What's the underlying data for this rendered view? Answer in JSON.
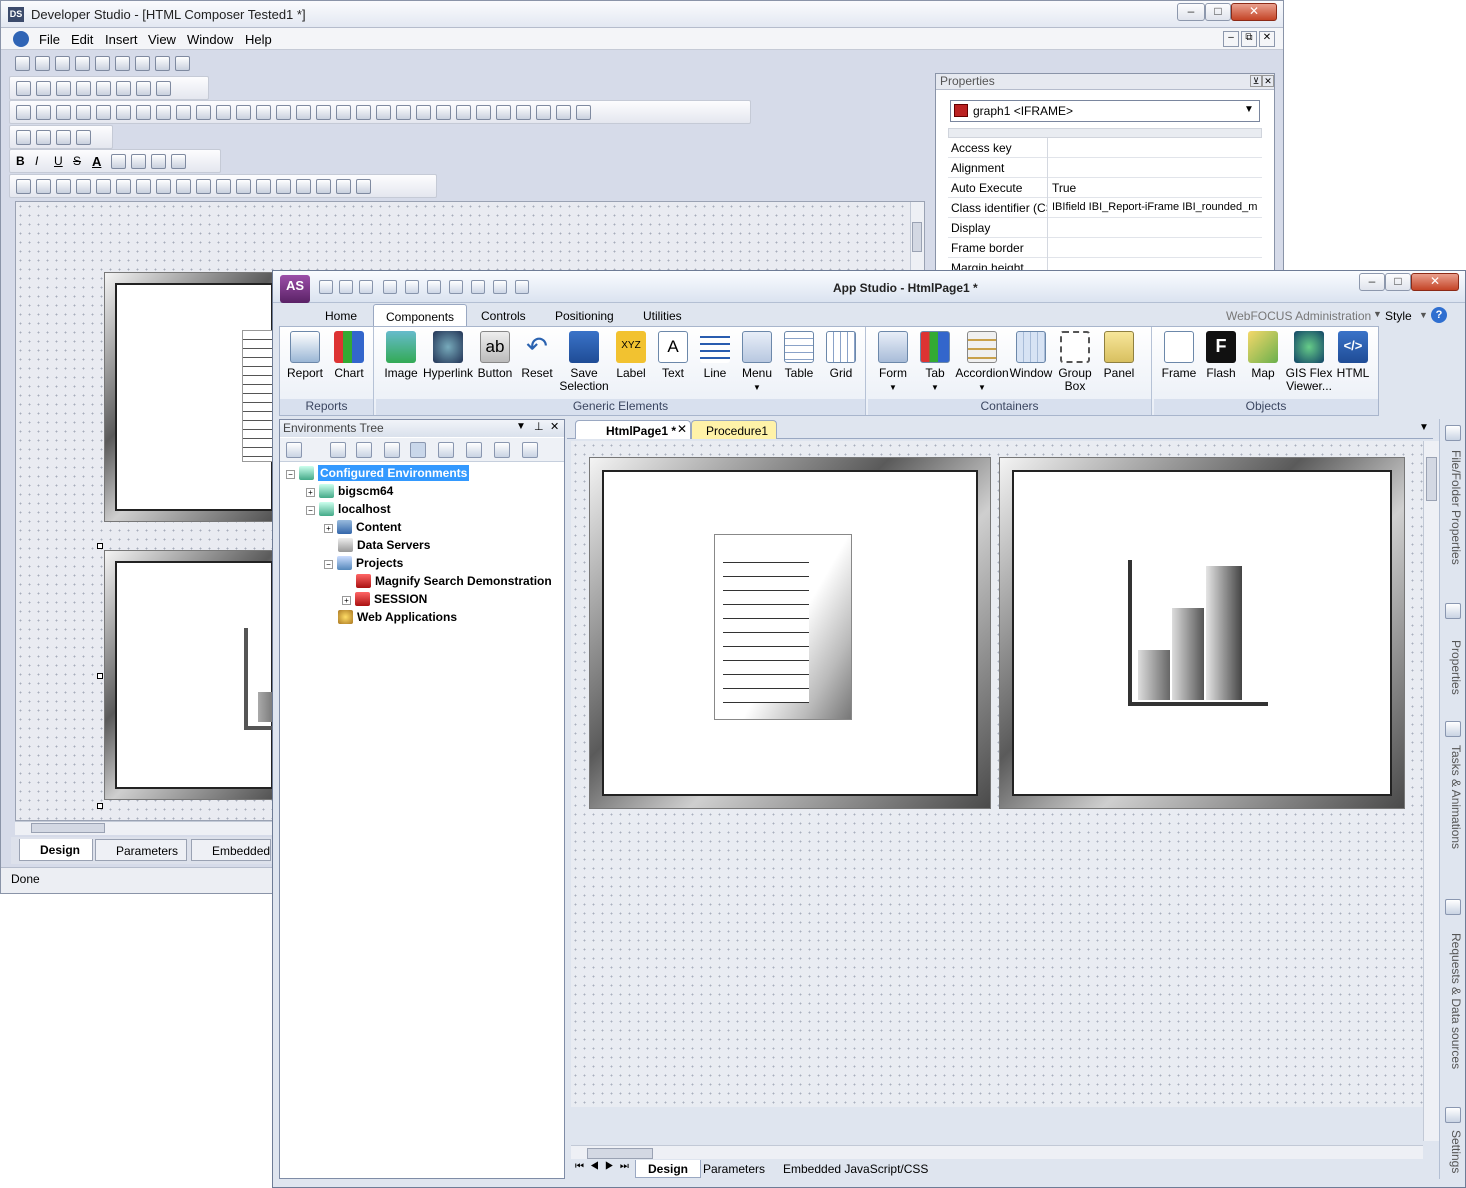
{
  "ds": {
    "title": "Developer Studio - [HTML Composer Tested1 *]",
    "menu": [
      "File",
      "Edit",
      "Insert",
      "View",
      "Window",
      "Help"
    ],
    "properties": {
      "header": "Properties",
      "selected": "graph1 <IFRAME>",
      "rows": [
        {
          "name": "Access key",
          "value": ""
        },
        {
          "name": "Alignment",
          "value": ""
        },
        {
          "name": "Auto Execute",
          "value": "True"
        },
        {
          "name": "Class identifier (CSS)",
          "value": "IBIfield IBI_Report-iFrame IBI_rounded_m"
        },
        {
          "name": "Display",
          "value": ""
        },
        {
          "name": "Frame border",
          "value": ""
        },
        {
          "name": "Margin height",
          "value": ""
        }
      ]
    },
    "tabs": [
      "Design",
      "Parameters",
      "Embedded"
    ],
    "status": "Done"
  },
  "as": {
    "title": "App Studio - HtmlPage1 *",
    "logo": "AS",
    "ribbon_tabs": [
      "Home",
      "Components",
      "Controls",
      "Positioning",
      "Utilities"
    ],
    "admin_label": "WebFOCUS Administration",
    "style_label": "Style",
    "groups": [
      {
        "label": "Reports",
        "buttons": [
          "Report",
          "Chart"
        ]
      },
      {
        "label": "Generic Elements",
        "buttons": [
          "Image",
          "Hyperlink",
          "Button",
          "Reset",
          "Save Selection",
          "Label",
          "Text",
          "Line",
          "Menu",
          "Table",
          "Grid"
        ]
      },
      {
        "label": "Containers",
        "buttons": [
          "Form",
          "Tab",
          "Accordion",
          "Window",
          "Group Box",
          "Panel"
        ]
      },
      {
        "label": "Objects",
        "buttons": [
          "Frame",
          "Flash",
          "Map",
          "GIS Flex Viewer...",
          "HTML"
        ]
      }
    ],
    "envtree": {
      "title": "Environments Tree",
      "nodes": [
        "Configured Environments",
        "bigscm64",
        "localhost",
        "Content",
        "Data Servers",
        "Projects",
        "Magnify Search Demonstration",
        "SESSION",
        "Web Applications"
      ]
    },
    "doc_tabs": [
      "HtmlPage1 *",
      "Procedure1"
    ],
    "bottom_tabs": [
      "Design",
      "Parameters",
      "Embedded JavaScript/CSS"
    ],
    "side_tabs": [
      "File/Folder Properties",
      "Properties",
      "Tasks & Animations",
      "Requests & Data sources",
      "Settings"
    ],
    "colors": {
      "accent": "#3399ff",
      "procedure_tab": "#fff2a8",
      "ribbon_bg": "#e9eef6"
    }
  }
}
